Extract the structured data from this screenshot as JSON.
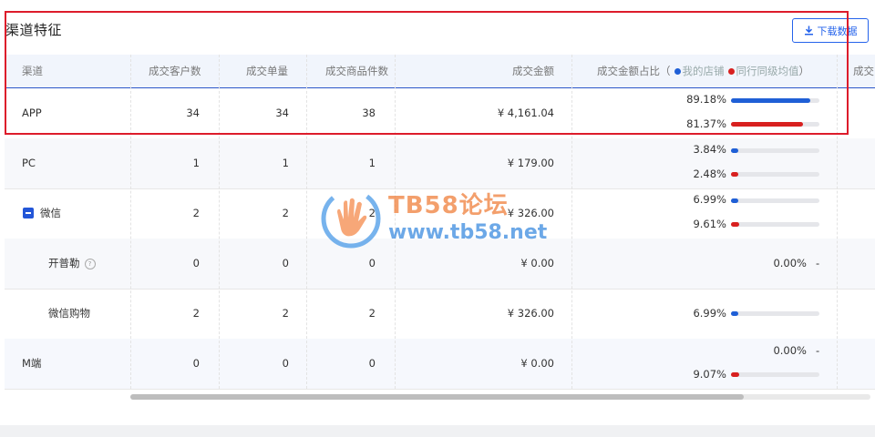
{
  "section": {
    "title": "渠道特征",
    "download_label": "下载数据"
  },
  "table": {
    "headers": {
      "channel": "渠道",
      "customers": "成交客户数",
      "orders": "成交单量",
      "items": "成交商品件数",
      "amount": "成交金额",
      "share": "成交金额占比（",
      "legend_mine": "我的店铺",
      "legend_peer": "同行同级均值",
      "share_close": "）",
      "next": "成交"
    },
    "rows": [
      {
        "channel": "APP",
        "customers": "34",
        "orders": "34",
        "items": "38",
        "amount": "¥ 4,161.04",
        "mine": "89.18%",
        "mine_value": 0.8918,
        "peer": "81.37%",
        "peer_value": 0.8137
      },
      {
        "channel": "PC",
        "customers": "1",
        "orders": "1",
        "items": "1",
        "amount": "¥ 179.00",
        "mine": "3.84%",
        "mine_value": 0.0384,
        "peer": "2.48%",
        "peer_value": 0.0248
      },
      {
        "channel": "微信",
        "customers": "2",
        "orders": "2",
        "items": "2",
        "amount": "¥ 326.00",
        "mine": "6.99%",
        "mine_value": 0.0699,
        "peer": "9.61%",
        "peer_value": 0.0961
      },
      {
        "channel": "开普勒",
        "customers": "0",
        "orders": "0",
        "items": "0",
        "amount": "¥ 0.00",
        "single": "0.00%",
        "dash": "-"
      },
      {
        "channel": "微信购物",
        "customers": "2",
        "orders": "2",
        "items": "2",
        "amount": "¥ 326.00",
        "single": "6.99%",
        "single_value": 0.0699
      },
      {
        "channel": "M端",
        "customers": "0",
        "orders": "0",
        "items": "0",
        "amount": "¥ 0.00",
        "mine": "0.00%",
        "dash": "-",
        "peer": "9.07%",
        "peer_value": 0.0907
      }
    ]
  },
  "colors": {
    "mine": "#1f5fd6",
    "peer": "#d8201f",
    "highlight_border": "#dd1c2b"
  },
  "watermark": {
    "title": "TB58论坛",
    "url": "www.tb58.net"
  }
}
